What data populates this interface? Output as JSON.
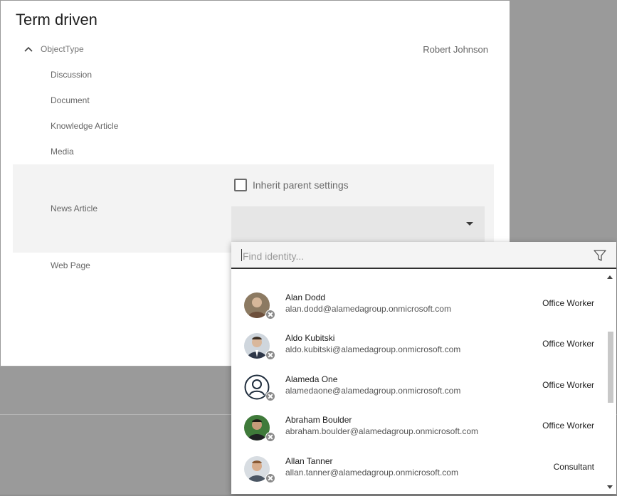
{
  "dialog": {
    "title": "Term driven",
    "tree_header": "ObjectType",
    "owner": "Robert Johnson",
    "items": [
      "Discussion",
      "Document",
      "Knowledge Article",
      "Media",
      "News Article",
      "Web Page"
    ]
  },
  "settings": {
    "inherit_label": "Inherit parent settings",
    "inherit_checked": false
  },
  "picker": {
    "placeholder": "Find identity...",
    "scroll_position": 0.2,
    "identities": [
      {
        "name": "Alan Dodd",
        "email": "alan.dodd@alamedagroup.onmicrosoft.com",
        "role": "Office Worker",
        "avatar": "photo"
      },
      {
        "name": "Aldo Kubitski",
        "email": "aldo.kubitski@alamedagroup.onmicrosoft.com",
        "role": "Office Worker",
        "avatar": "photo"
      },
      {
        "name": "Alameda One",
        "email": "alamedaone@alamedagroup.onmicrosoft.com",
        "role": "Office Worker",
        "avatar": "person-outline-icon"
      },
      {
        "name": "Abraham Boulder",
        "email": "abraham.boulder@alamedagroup.onmicrosoft.com",
        "role": "Office Worker",
        "avatar": "photo"
      },
      {
        "name": "Allan Tanner",
        "email": "allan.tanner@alamedagroup.onmicrosoft.com",
        "role": "Consultant",
        "avatar": "photo"
      }
    ]
  },
  "colors": {
    "overlay": "#9a9a9a",
    "selected_row": "#f3f3f3",
    "input_bg": "#e6e6e6"
  }
}
